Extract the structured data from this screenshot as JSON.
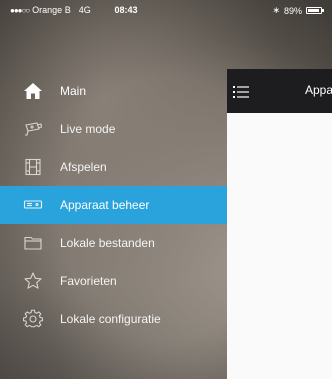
{
  "status_bar": {
    "signal": "●●●○○",
    "carrier": "Orange B",
    "network": "4G",
    "time": "08:43",
    "bluetooth": "∗",
    "battery": "89%"
  },
  "pane": {
    "title": "Appa"
  },
  "menu": {
    "items": [
      {
        "label": "Main",
        "icon": "home-icon",
        "active": false
      },
      {
        "label": "Live mode",
        "icon": "camera-icon",
        "active": false
      },
      {
        "label": "Afspelen",
        "icon": "film-icon",
        "active": false
      },
      {
        "label": "Apparaat beheer",
        "icon": "device-icon",
        "active": true
      },
      {
        "label": "Lokale bestanden",
        "icon": "folder-icon",
        "active": false
      },
      {
        "label": "Favorieten",
        "icon": "star-icon",
        "active": false
      },
      {
        "label": "Lokale configuratie",
        "icon": "gear-icon",
        "active": false
      }
    ]
  },
  "colors": {
    "accent": "#2aa3dc",
    "header": "#1d1d1f"
  }
}
